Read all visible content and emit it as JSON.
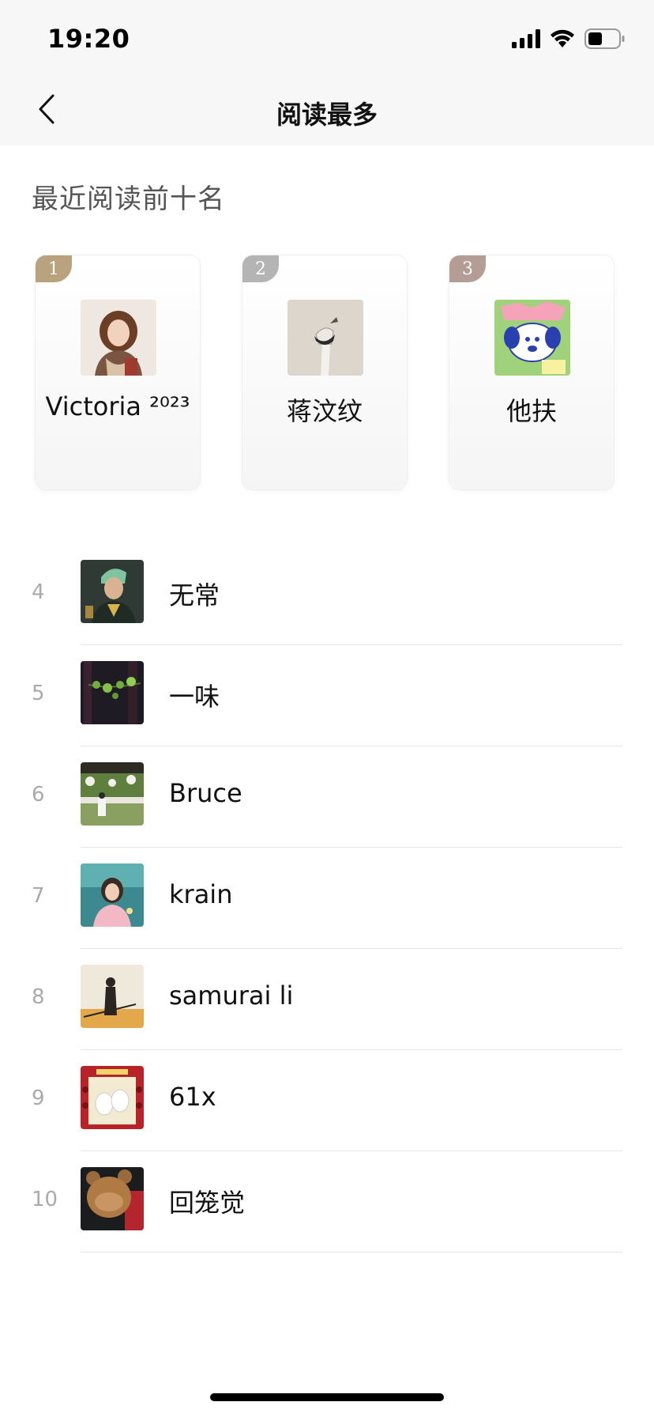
{
  "status_bar": {
    "time": "19:20"
  },
  "nav": {
    "title": "阅读最多"
  },
  "section_title": "最近阅读前十名",
  "podium": [
    {
      "rank": "1",
      "name": "Victoria ²⁰²³",
      "badge_color": "#b9a37e",
      "avatar_icon": "woman-portrait-avatar"
    },
    {
      "rank": "2",
      "name": "蒋汶纹",
      "badge_color": "#b4b4b4",
      "avatar_icon": "hand-sketch-avatar"
    },
    {
      "rank": "3",
      "name": "他扶",
      "badge_color": "#b39d95",
      "avatar_icon": "cartoon-dog-avatar"
    }
  ],
  "list": [
    {
      "rank": "4",
      "name": "无常",
      "avatar_icon": "character-portrait-avatar"
    },
    {
      "rank": "5",
      "name": "一味",
      "avatar_icon": "plant-branch-avatar"
    },
    {
      "rank": "6",
      "name": "Bruce",
      "avatar_icon": "landscape-photo-avatar"
    },
    {
      "rank": "7",
      "name": "krain",
      "avatar_icon": "girl-photo-avatar"
    },
    {
      "rank": "8",
      "name": "samurai li",
      "avatar_icon": "samurai-silhouette-avatar"
    },
    {
      "rank": "9",
      "name": "61x",
      "avatar_icon": "cats-poster-avatar"
    },
    {
      "rank": "10",
      "name": "回笼觉",
      "avatar_icon": "bear-photo-avatar"
    }
  ]
}
